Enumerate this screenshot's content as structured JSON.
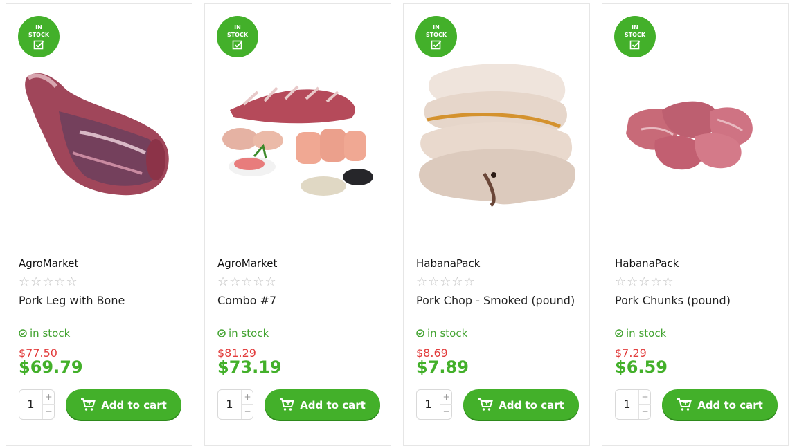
{
  "colors": {
    "accent": "#43b02a",
    "old_price": "#e23c3c",
    "stock_text": "#43a331"
  },
  "badge": {
    "line1": "IN",
    "line2": "STOCK",
    "icon": "checkbox-icon"
  },
  "cart_icon": "shopping-cart-icon",
  "products": [
    {
      "vendor": "AgroMarket",
      "stars": "☆☆☆☆☆",
      "rating": 0,
      "name": "Pork Leg with Bone",
      "stock_label": "in stock",
      "old_price": "$77.50",
      "price": "$69.79",
      "quantity": "1",
      "qty_up": "+",
      "qty_down": "−",
      "cart_label": "Add to cart"
    },
    {
      "vendor": "AgroMarket",
      "stars": "☆☆☆☆☆",
      "rating": 0,
      "name": "Combo #7",
      "stock_label": "in stock",
      "old_price": "$81.29",
      "price": "$73.19",
      "quantity": "1",
      "qty_up": "+",
      "qty_down": "−",
      "cart_label": "Add to cart"
    },
    {
      "vendor": "HabanaPack",
      "stars": "☆☆☆☆☆",
      "rating": 0,
      "name": "Pork Chop - Smoked (pound)",
      "stock_label": "in stock",
      "old_price": "$8.69",
      "price": "$7.89",
      "quantity": "1",
      "qty_up": "+",
      "qty_down": "−",
      "cart_label": "Add to cart"
    },
    {
      "vendor": "HabanaPack",
      "stars": "☆☆☆☆☆",
      "rating": 0,
      "name": "Pork Chunks (pound)",
      "stock_label": "in stock",
      "old_price": "$7.29",
      "price": "$6.59",
      "quantity": "1",
      "qty_up": "+",
      "qty_down": "−",
      "cart_label": "Add to cart"
    }
  ]
}
